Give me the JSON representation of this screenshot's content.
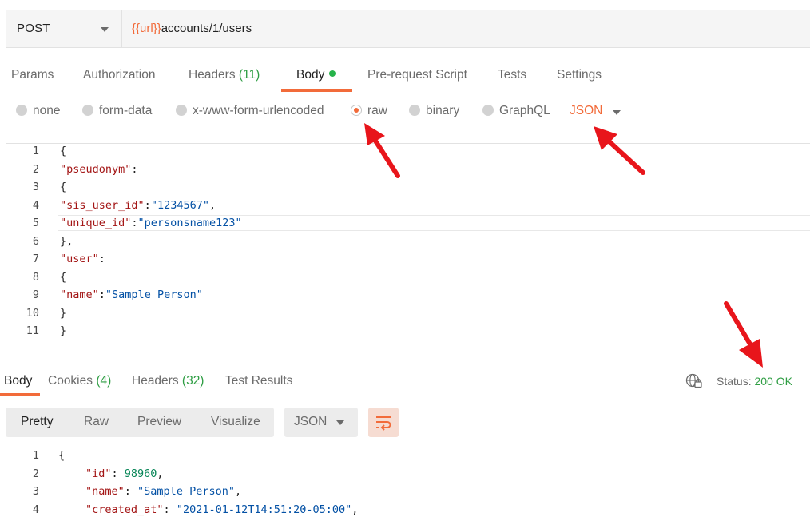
{
  "request": {
    "method": "POST",
    "url_variable": "{{url}}",
    "url_path": "accounts/1/users"
  },
  "request_tabs": [
    {
      "label": "Params"
    },
    {
      "label": "Authorization"
    },
    {
      "label": "Headers",
      "count": "(11)"
    },
    {
      "label": "Body"
    },
    {
      "label": "Pre-request Script"
    },
    {
      "label": "Tests"
    },
    {
      "label": "Settings"
    }
  ],
  "body_types": [
    {
      "label": "none",
      "selected": false
    },
    {
      "label": "form-data",
      "selected": false
    },
    {
      "label": "x-www-form-urlencoded",
      "selected": false
    },
    {
      "label": "raw",
      "selected": true
    },
    {
      "label": "binary",
      "selected": false
    },
    {
      "label": "GraphQL",
      "selected": false
    }
  ],
  "raw_format": "JSON",
  "request_body": {
    "line_numbers": [
      "1",
      "2",
      "3",
      "4",
      "5",
      "6",
      "7",
      "8",
      "9",
      "10",
      "11"
    ],
    "lines": [
      [
        "{"
      ],
      [
        "\"pseudonym\"",
        ":"
      ],
      [
        "{"
      ],
      [
        "\"sis_user_id\"",
        ":",
        "\"1234567\"",
        ","
      ],
      [
        "\"unique_id\"",
        ":",
        "\"personsname123\""
      ],
      [
        "},"
      ],
      [
        "\"user\"",
        ":"
      ],
      [
        "{"
      ],
      [
        "\"name\"",
        ":",
        "\"Sample Person\""
      ],
      [
        "}"
      ],
      [
        "}"
      ]
    ]
  },
  "response_tabs": [
    {
      "label": "Body"
    },
    {
      "label": "Cookies",
      "count": "(4)"
    },
    {
      "label": "Headers",
      "count": "(32)"
    },
    {
      "label": "Test Results"
    }
  ],
  "status": {
    "label": "Status:",
    "value": "200 OK"
  },
  "view_modes": [
    "Pretty",
    "Raw",
    "Preview",
    "Visualize"
  ],
  "response_format": "JSON",
  "response_body": {
    "line_numbers": [
      "1",
      "2",
      "3",
      "4"
    ],
    "lines": [
      [
        "{"
      ],
      [
        "\"id\"",
        ": ",
        "98960",
        ","
      ],
      [
        "\"name\"",
        ": ",
        "\"Sample Person\"",
        ","
      ],
      [
        "\"created_at\"",
        ": ",
        "\"2021-01-12T14:51:20-05:00\"",
        ","
      ]
    ]
  },
  "colors": {
    "accent": "#f26b3a",
    "count_green": "#2f9e44",
    "annotation_arrow": "#e8151b"
  },
  "icons": [
    "chevron-down-icon",
    "globe-lock-icon",
    "wrap-lines-icon",
    "annotation-arrow"
  ]
}
